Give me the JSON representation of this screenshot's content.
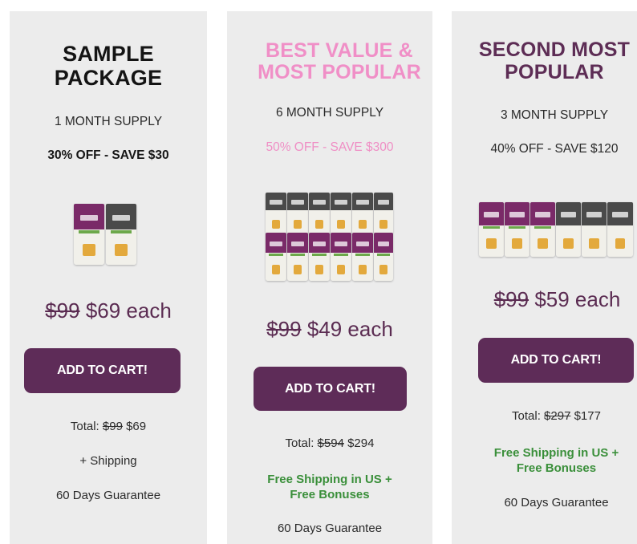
{
  "cards": [
    {
      "title_line1": "SAMPLE",
      "title_line2": "PACKAGE",
      "supply": "1 MONTH SUPPLY",
      "discount": "30% OFF - SAVE $30",
      "old_price": "$99",
      "new_price": "$69 each",
      "button": "ADD TO CART!",
      "total_label": "Total:",
      "total_old": "$99",
      "total_new": "$69",
      "shipping": "+ Shipping",
      "guarantee": "60 Days Guarantee"
    },
    {
      "title_line1": "BEST VALUE &",
      "title_line2": "MOST POPULAR",
      "supply": "6 MONTH SUPPLY",
      "discount": "50% OFF - SAVE $300",
      "old_price": "$99",
      "new_price": "$49 each",
      "button": "ADD TO CART!",
      "total_label": "Total:",
      "total_old": "$594",
      "total_new": "$294",
      "shipping_line1": "Free Shipping in US +",
      "shipping_line2": "Free Bonuses",
      "guarantee": "60 Days Guarantee"
    },
    {
      "title_line1": "SECOND MOST",
      "title_line2": "POPULAR",
      "supply": "3 MONTH SUPPLY",
      "discount": "40% OFF - SAVE $120",
      "old_price": "$99",
      "new_price": "$59 each",
      "button": "ADD TO CART!",
      "total_label": "Total:",
      "total_old": "$297",
      "total_new": "$177",
      "shipping_line1": "Free Shipping in US +",
      "shipping_line2": "Free Bonuses",
      "guarantee": "60 Days Guarantee"
    }
  ],
  "colors": {
    "plum": "#5e2c58",
    "pink": "#f08fc7",
    "green": "#3a8f3a",
    "card_bg": "#ececec"
  }
}
